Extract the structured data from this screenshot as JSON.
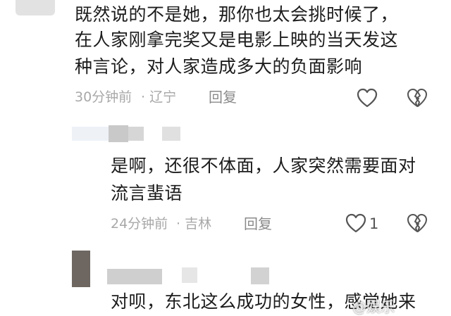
{
  "comments": [
    {
      "text_lines": [
        "既然说的不是她，那你也太会挑时候了，",
        "在人家刚拿完奖又是电影上映的当天发这",
        "种言论，对人家造成多大的负面影响"
      ],
      "time": "30分钟前",
      "location": "· 辽宁",
      "reply_label": "回复",
      "like_icon": "heart-outline-icon",
      "dislike_icon": "broken-heart-icon"
    },
    {
      "text_lines": [
        "是啊，还很不体面，人家突然需要面对",
        "流言蜚语"
      ],
      "time": "24分钟前",
      "location": "· 吉林",
      "reply_label": "回复",
      "like_count": "1",
      "like_icon": "heart-outline-icon",
      "dislike_icon": "broken-heart-icon"
    },
    {
      "text_lines": [
        "对呗，东北这么成功的女性，感觉她来"
      ]
    }
  ],
  "watermark": "@娱乐"
}
